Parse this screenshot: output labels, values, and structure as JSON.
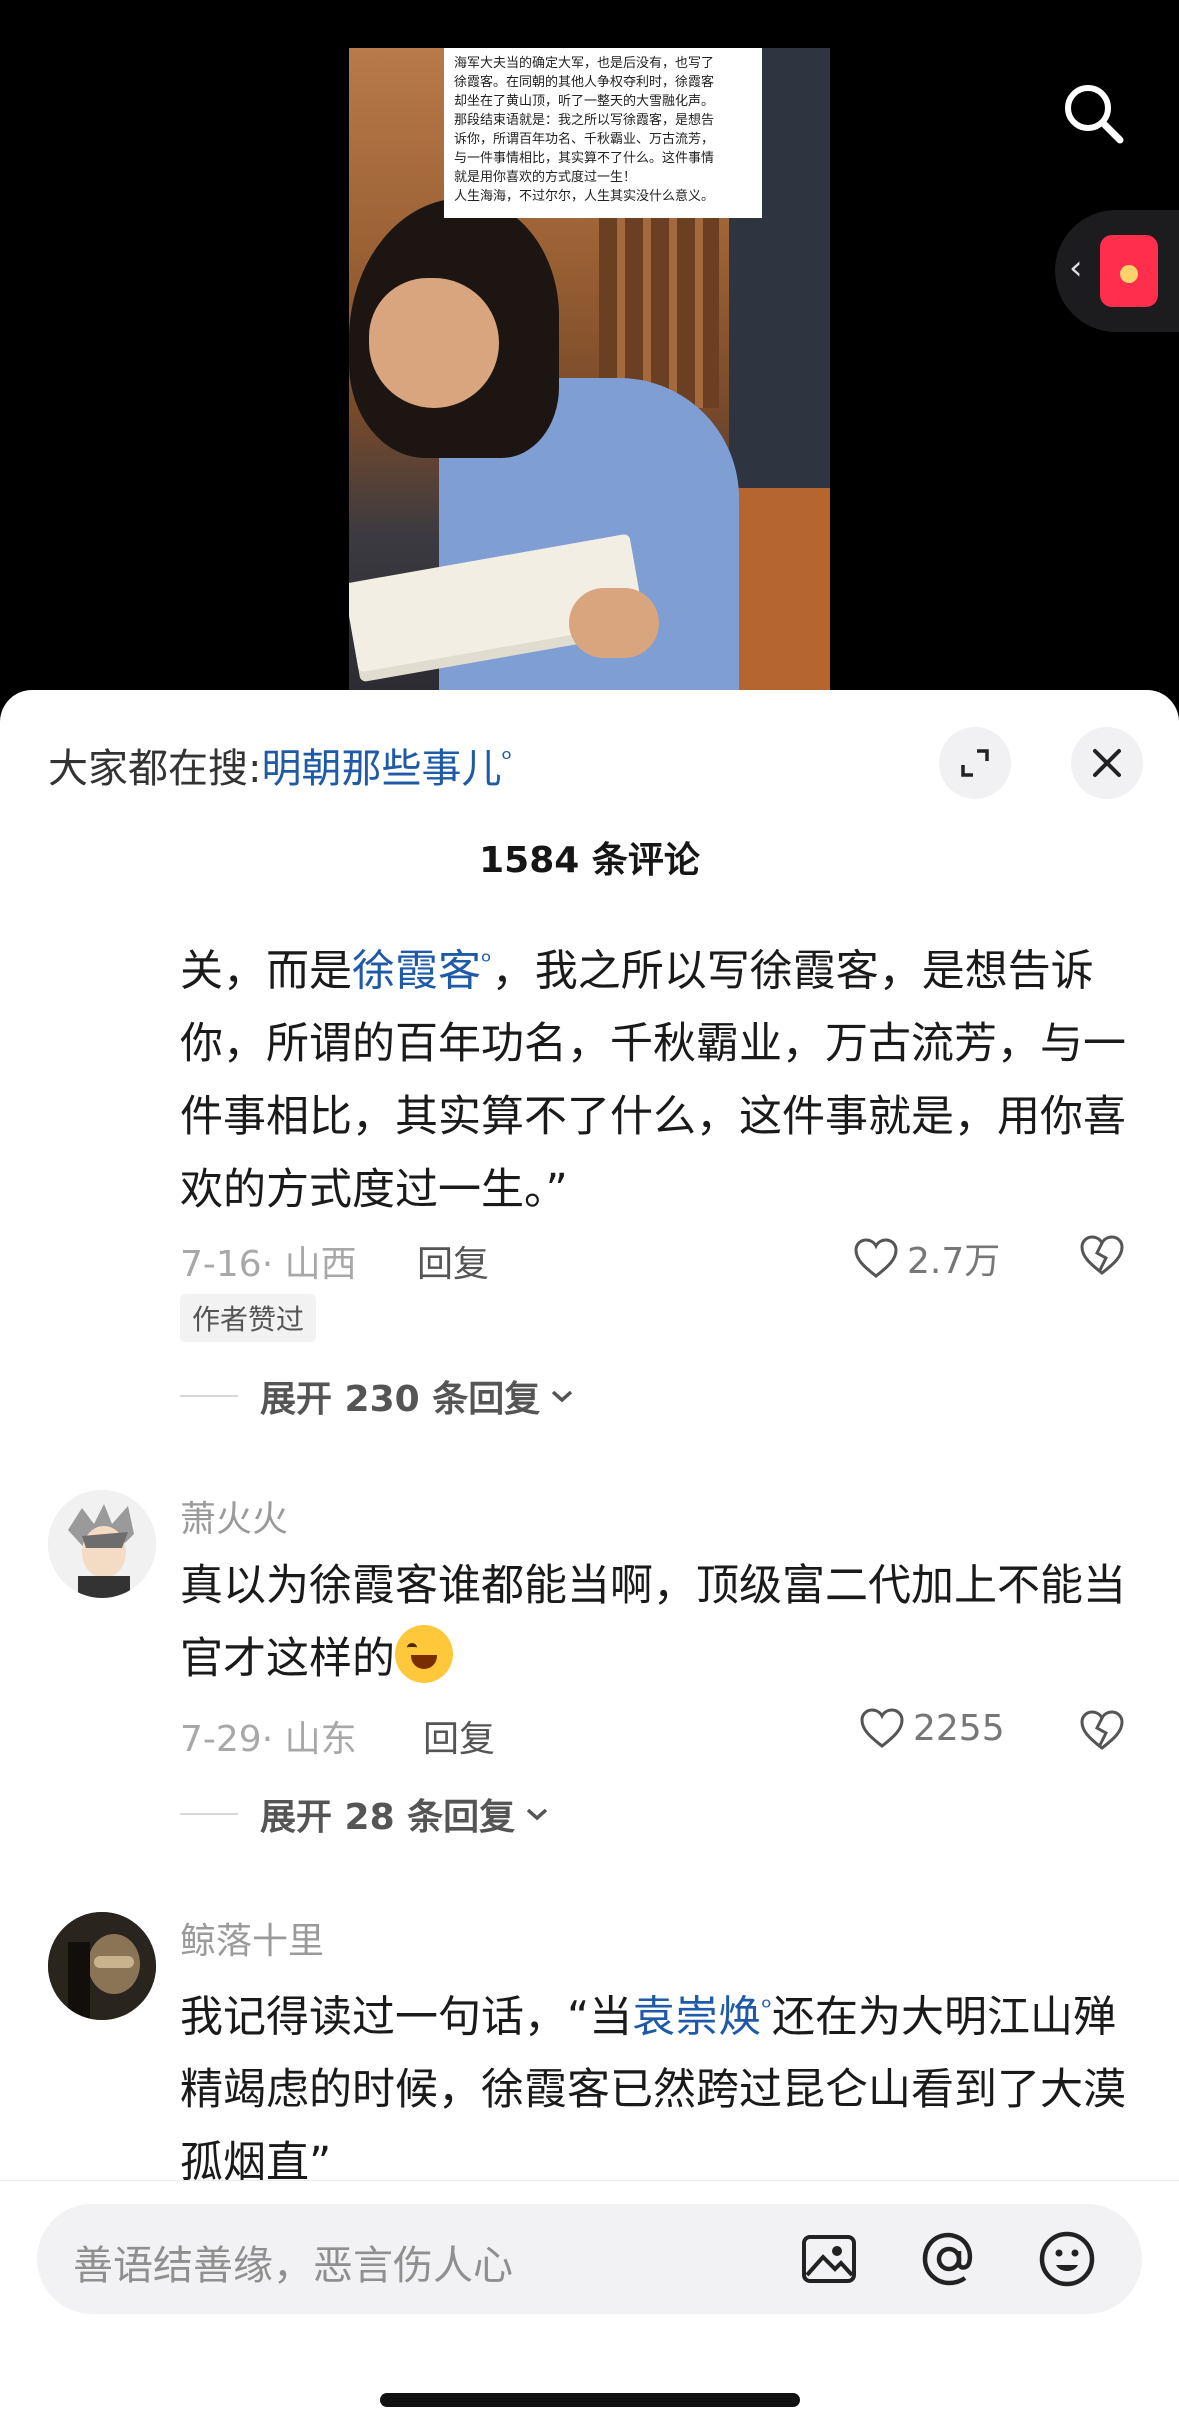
{
  "video": {
    "overlay_text": [
      "海军大夫当的确定大军，也是后没有，也写了",
      "徐霞客。在同朝的其他人争权夺利时，徐霞客",
      "却坐在了黄山顶，听了一整天的大雪融化声。",
      "那段结束语就是：我之所以写徐霞客，是想告",
      "诉你，所谓百年功名、千秋霸业、万古流芳，",
      "与一件事情相比，其实算不了什么。这件事情",
      "就是用你喜欢的方式度过一生！",
      "人生海海，不过尔尔，人生其实没什么意义。"
    ]
  },
  "header": {
    "search_prefix": "大家都在搜:",
    "search_keyword": "明朝那些事儿",
    "comment_count_title": "1584 条评论"
  },
  "comments": [
    {
      "text_before": "关，而是",
      "link": "徐霞客",
      "text_after": "，我之所以写徐霞客，是想告诉你，所谓的百年功名，千秋霸业，万古流芳，与一件事相比，其实算不了什么，这件事就是，用你喜欢的方式度过一生。”",
      "meta": "7-16· 山西",
      "reply_label": "回复",
      "likes": "2.7万",
      "badge": "作者赞过",
      "expand_label": "展开 230 条回复"
    },
    {
      "username": "萧火火",
      "text": "真以为徐霞客谁都能当啊，顶级富二代加上不能当官才这样的",
      "meta": "7-29· 山东",
      "reply_label": "回复",
      "likes": "2255",
      "expand_label": "展开 28 条回复"
    },
    {
      "username": "鲸落十里",
      "text_before": "我记得读过一句话，“当",
      "link": "袁崇焕",
      "text_after": "还在为大明江山殚精竭虑的时候，徐霞客已然跨过昆仑山看到了大漠孤烟直”"
    }
  ],
  "input": {
    "placeholder": "善语结善缘，恶言伤人心"
  },
  "colors": {
    "link": "#1e5aa8",
    "sheet_bg": "#ffffff",
    "input_bg": "#f2f2f4"
  },
  "icons": [
    "search-icon",
    "red-envelope-icon",
    "expand-icon",
    "close-icon",
    "heart-icon",
    "broken-heart-icon",
    "image-icon",
    "at-icon",
    "emoji-icon",
    "chevron-down-icon"
  ]
}
